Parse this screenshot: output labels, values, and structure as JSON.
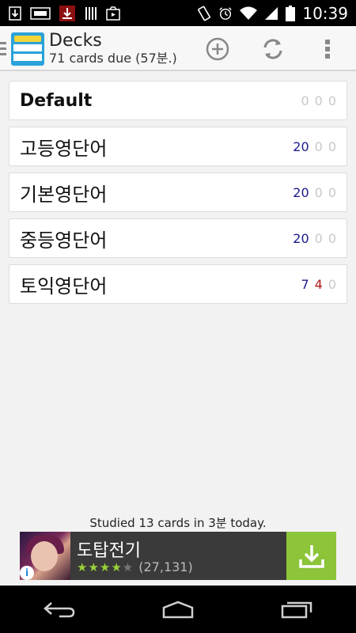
{
  "status_bar": {
    "time": "10:39",
    "left_icons": [
      "download-icon",
      "image-icon",
      "app-icon",
      "barcode-icon",
      "media-icon"
    ],
    "right_icons": [
      "vibrate-icon",
      "alarm-icon",
      "wifi-icon",
      "signal-icon",
      "battery-icon"
    ]
  },
  "action_bar": {
    "title": "Decks",
    "subtitle": "71 cards due (57분.)",
    "actions": [
      "add-icon",
      "sync-icon",
      "overflow-menu-icon"
    ]
  },
  "decks": [
    {
      "name": "Default",
      "counts": [
        "0",
        "0",
        "0"
      ],
      "bold": true
    },
    {
      "name": "고등영단어",
      "counts": [
        "20",
        "0",
        "0"
      ]
    },
    {
      "name": "기본영단어",
      "counts": [
        "20",
        "0",
        "0"
      ]
    },
    {
      "name": "중등영단어",
      "counts": [
        "20",
        "0",
        "0"
      ]
    },
    {
      "name": "토익영단어",
      "counts": [
        "7",
        "4",
        "0"
      ]
    }
  ],
  "colors": {
    "new_count": "#1a1a8a",
    "learn_count": "#b01818",
    "zero_count": "#c8c8c8",
    "ad_accent": "#8cc43a"
  },
  "footer": {
    "studied": "Studied 13 cards in 3분 today."
  },
  "ad": {
    "title": "도탑전기",
    "rating": 4,
    "rating_count": "(27,131)"
  }
}
